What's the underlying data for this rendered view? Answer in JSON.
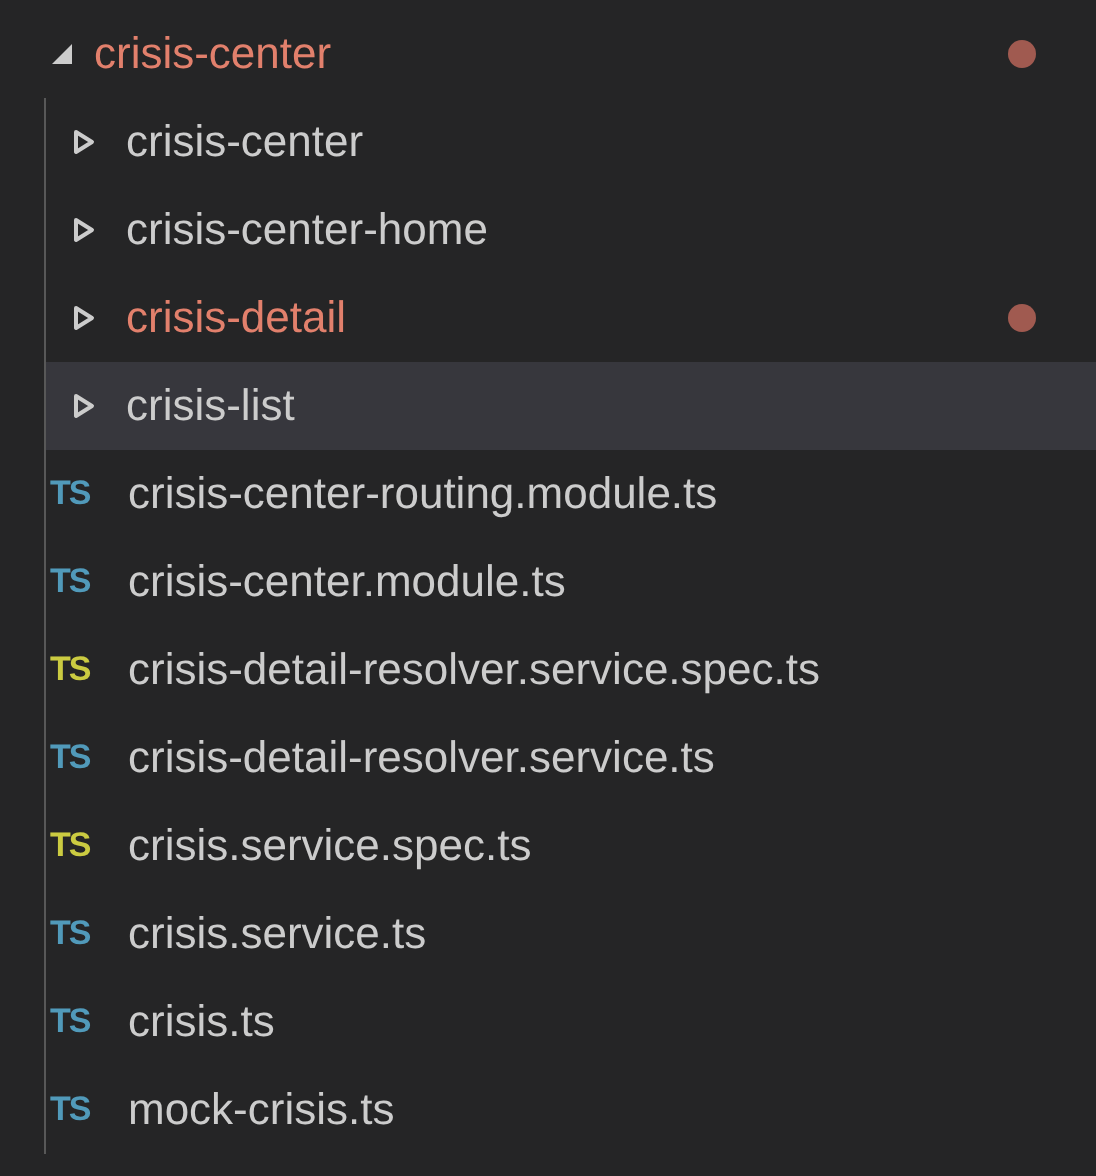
{
  "tree": {
    "label": "crisis-center",
    "expanded": true,
    "modified": true,
    "selected": false,
    "children": [
      {
        "kind": "folder",
        "label": "crisis-center",
        "expanded": false,
        "modified": false,
        "selected": false
      },
      {
        "kind": "folder",
        "label": "crisis-center-home",
        "expanded": false,
        "modified": false,
        "selected": false
      },
      {
        "kind": "folder",
        "label": "crisis-detail",
        "expanded": false,
        "modified": true,
        "selected": false
      },
      {
        "kind": "folder",
        "label": "crisis-list",
        "expanded": false,
        "modified": false,
        "selected": true
      },
      {
        "kind": "file",
        "label": "crisis-center-routing.module.ts",
        "icon": "TS",
        "color": "#519aba",
        "selected": false
      },
      {
        "kind": "file",
        "label": "crisis-center.module.ts",
        "icon": "TS",
        "color": "#519aba",
        "selected": false
      },
      {
        "kind": "file",
        "label": "crisis-detail-resolver.service.spec.ts",
        "icon": "TS",
        "color": "#cbcb41",
        "selected": false
      },
      {
        "kind": "file",
        "label": "crisis-detail-resolver.service.ts",
        "icon": "TS",
        "color": "#519aba",
        "selected": false
      },
      {
        "kind": "file",
        "label": "crisis.service.spec.ts",
        "icon": "TS",
        "color": "#cbcb41",
        "selected": false
      },
      {
        "kind": "file",
        "label": "crisis.service.ts",
        "icon": "TS",
        "color": "#519aba",
        "selected": false
      },
      {
        "kind": "file",
        "label": "crisis.ts",
        "icon": "TS",
        "color": "#519aba",
        "selected": false
      },
      {
        "kind": "file",
        "label": "mock-crisis.ts",
        "icon": "TS",
        "color": "#519aba",
        "selected": false
      }
    ]
  }
}
